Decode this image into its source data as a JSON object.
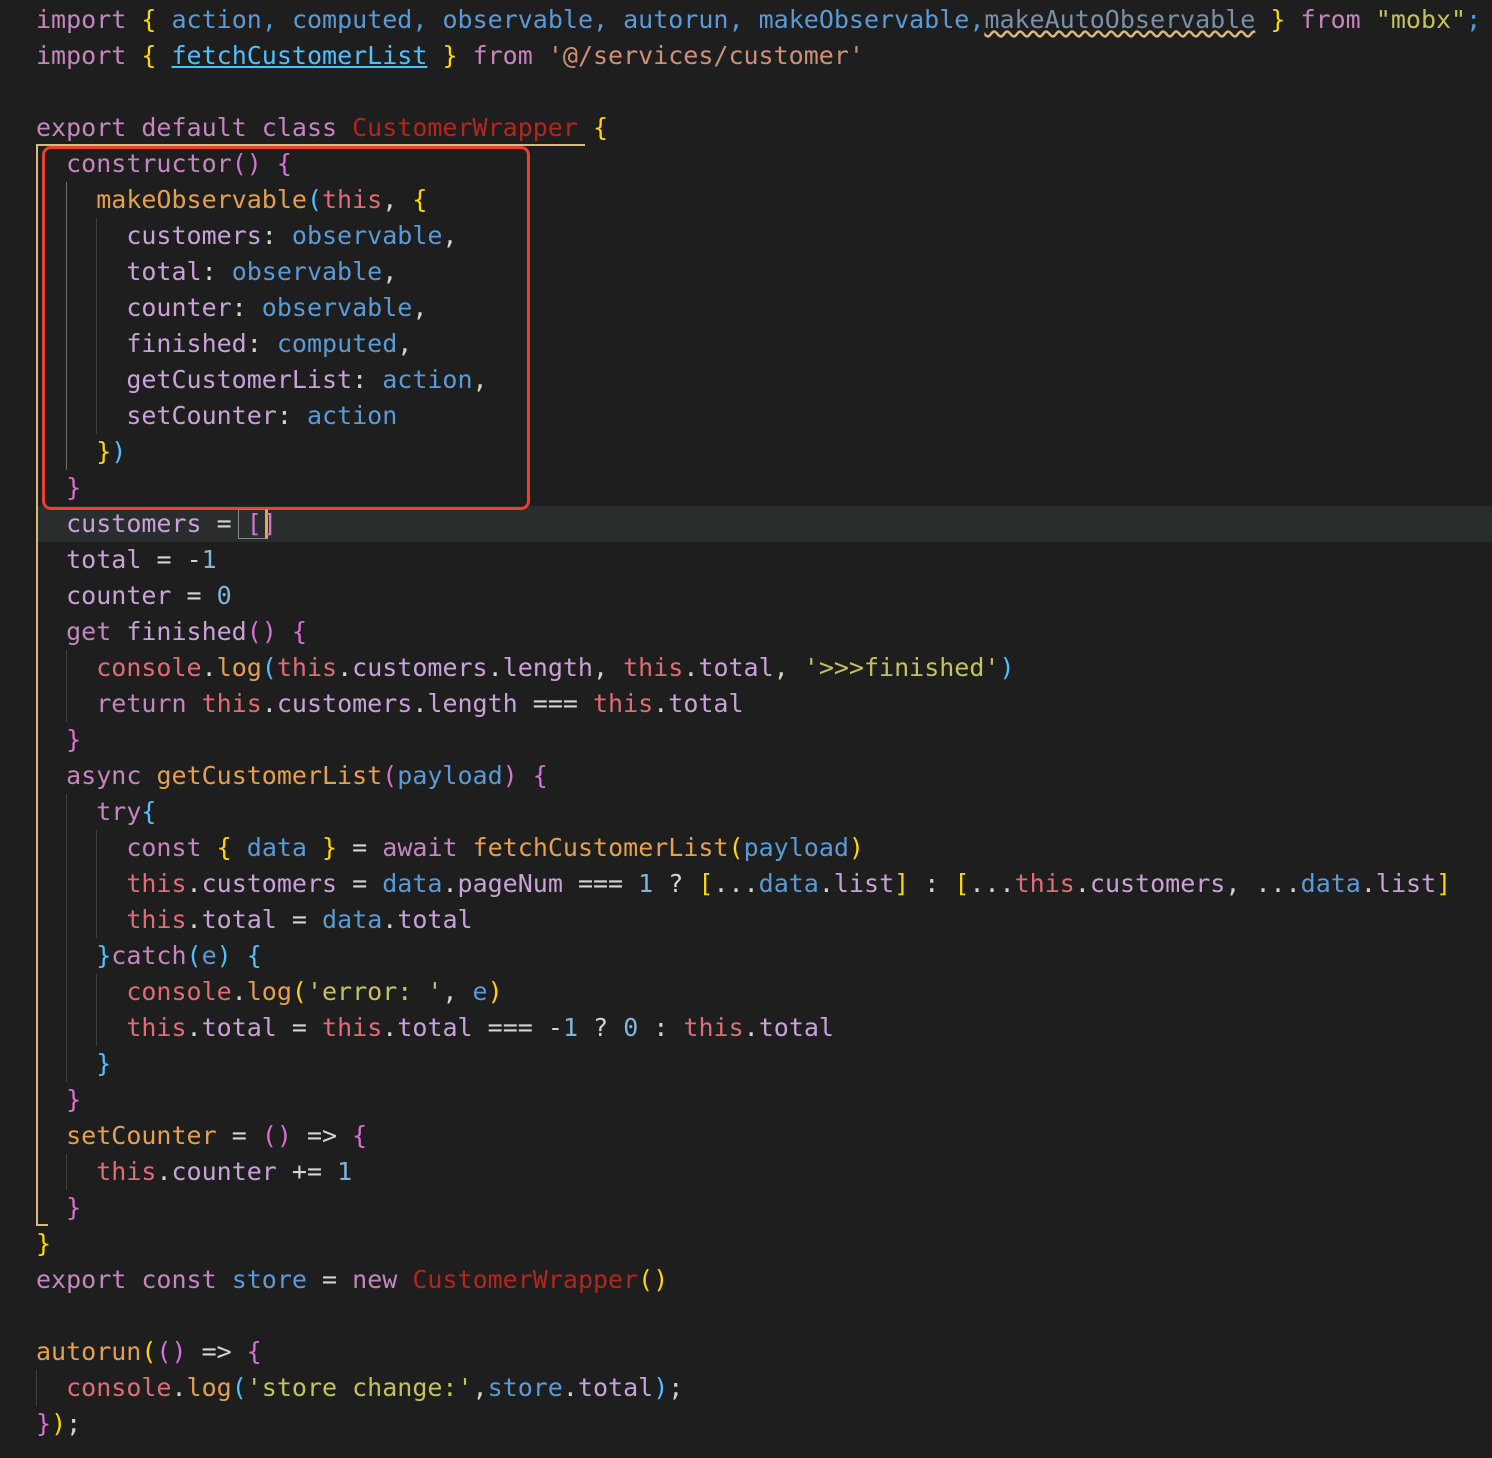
{
  "editor": {
    "highlight_color": "#e8422b",
    "background": "#1e1e1e",
    "lines": [
      "import { action, computed, observable, autorun, makeObservable,makeAutoObservable } from \"mobx\";",
      "import { fetchCustomerList } from '@/services/customer'",
      "",
      "export default class CustomerWrapper {",
      "  constructor() {",
      "    makeObservable(this, {",
      "      customers: observable,",
      "      total: observable,",
      "      counter: observable,",
      "      finished: computed,",
      "      getCustomerList: action,",
      "      setCounter: action",
      "    })",
      "  }",
      "  customers = []",
      "  total = -1",
      "  counter = 0",
      "  get finished() {",
      "    console.log(this.customers.length, this.total, '>>>finished')",
      "    return this.customers.length === this.total",
      "  }",
      "  async getCustomerList(payload) {",
      "    try{",
      "      const { data } = await fetchCustomerList(payload)",
      "      this.customers = data.pageNum === 1 ? [...data.list] : [...this.customers, ...data.list]",
      "      this.total = data.total",
      "    }catch(e) {",
      "      console.log('error: ', e)",
      "      this.total = this.total === -1 ? 0 : this.total",
      "    }",
      "  }",
      "  setCounter = () => {",
      "    this.counter += 1",
      "  }",
      "}",
      "export const store = new CustomerWrapper()",
      "",
      "autorun(() => {",
      "  console.log('store change:',store.total);",
      "});"
    ]
  }
}
